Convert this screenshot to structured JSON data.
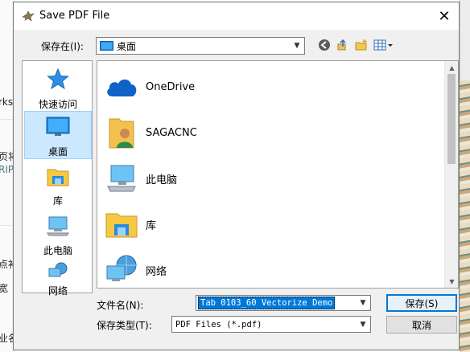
{
  "background": {
    "fragments": [
      "rks",
      "页将",
      "RIP",
      "点补",
      "宽",
      "业名"
    ]
  },
  "dialog": {
    "title": "Save PDF File",
    "close_glyph": "✕",
    "save_in_label": "保存在(I):",
    "save_in_value": "桌面",
    "toolbar": {
      "back_icon": "back-arrow-icon",
      "up_icon": "up-folder-icon",
      "new_folder_icon": "new-folder-icon",
      "view_icon": "view-menu-icon"
    },
    "places": [
      {
        "label": "快速访问",
        "icon": "star-icon"
      },
      {
        "label": "桌面",
        "icon": "desktop-icon"
      },
      {
        "label": "库",
        "icon": "library-icon"
      },
      {
        "label": "此电脑",
        "icon": "computer-icon"
      },
      {
        "label": "网络",
        "icon": "network-icon"
      }
    ],
    "files": [
      {
        "name": "OneDrive",
        "icon": "cloud-icon"
      },
      {
        "name": "SAGACNC",
        "icon": "user-folder-icon"
      },
      {
        "name": "此电脑",
        "icon": "computer-icon"
      },
      {
        "name": "库",
        "icon": "library-icon"
      },
      {
        "name": "网络",
        "icon": "network-icon"
      }
    ],
    "filename_label": "文件名(N):",
    "filename_value": "Tab 0103_60 Vectorize Demo",
    "filetype_label": "保存类型(T):",
    "filetype_value": "PDF Files (*.pdf)",
    "save_button": "保存(S)",
    "cancel_button": "取消"
  }
}
